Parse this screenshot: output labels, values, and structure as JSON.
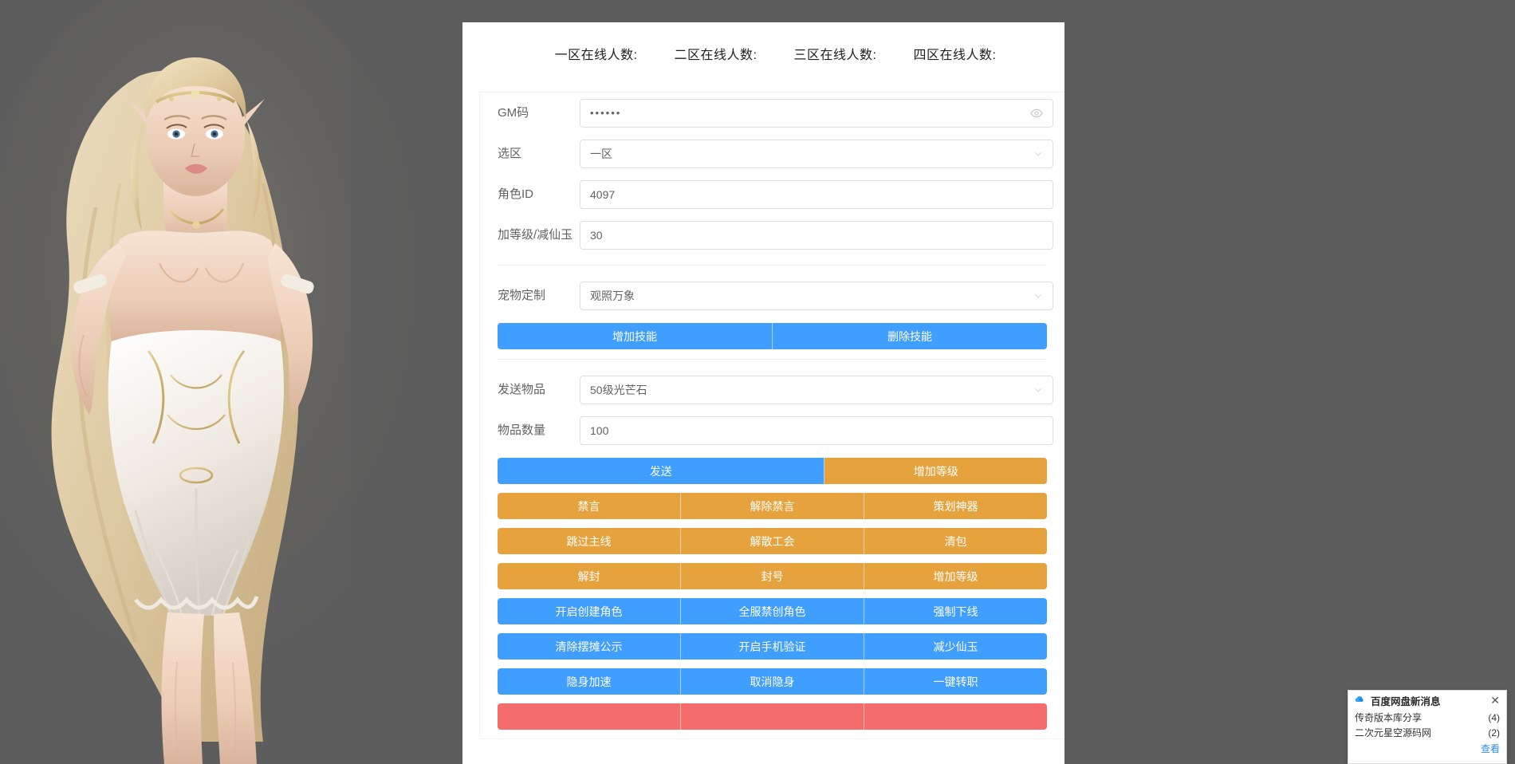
{
  "zone_header": {
    "counts": [
      "一区在线人数:",
      "二区在线人数:",
      "三区在线人数:",
      "四区在线人数:"
    ]
  },
  "form": {
    "gm_code": {
      "label": "GM码",
      "value": "••••••",
      "icon": "eye-icon"
    },
    "zone": {
      "label": "选区",
      "value": "一区"
    },
    "role_id": {
      "label": "角色ID",
      "value": "4097"
    },
    "level_jade": {
      "label": "加等级/减仙玉",
      "value": "30"
    },
    "pet_custom": {
      "label": "宠物定制",
      "value": "观照万象"
    },
    "send_item": {
      "label": "发送物品",
      "value": "50级光芒石"
    },
    "item_count": {
      "label": "物品数量",
      "value": "100"
    }
  },
  "skill_bar": [
    {
      "label": "增加技能",
      "color": "blue"
    },
    {
      "label": "删除技能",
      "color": "blue"
    }
  ],
  "send_bar": [
    {
      "label": "发送",
      "color": "blue"
    },
    {
      "label": "增加等级",
      "color": "orange"
    }
  ],
  "action_rows": [
    [
      {
        "label": "禁言",
        "color": "orange"
      },
      {
        "label": "解除禁言",
        "color": "orange"
      },
      {
        "label": "策划神器",
        "color": "orange"
      }
    ],
    [
      {
        "label": "跳过主线",
        "color": "orange"
      },
      {
        "label": "解散工会",
        "color": "orange"
      },
      {
        "label": "清包",
        "color": "orange"
      }
    ],
    [
      {
        "label": "解封",
        "color": "orange"
      },
      {
        "label": "封号",
        "color": "orange"
      },
      {
        "label": "增加等级",
        "color": "orange"
      }
    ],
    [
      {
        "label": "开启创建角色",
        "color": "blue"
      },
      {
        "label": "全服禁创角色",
        "color": "blue"
      },
      {
        "label": "强制下线",
        "color": "blue"
      }
    ],
    [
      {
        "label": "清除摆摊公示",
        "color": "blue"
      },
      {
        "label": "开启手机验证",
        "color": "blue"
      },
      {
        "label": "减少仙玉",
        "color": "blue"
      }
    ],
    [
      {
        "label": "隐身加速",
        "color": "blue"
      },
      {
        "label": "取消隐身",
        "color": "blue"
      },
      {
        "label": "一键转职",
        "color": "blue"
      }
    ],
    [
      {
        "label": "",
        "color": "red"
      },
      {
        "label": "",
        "color": "red"
      },
      {
        "label": "",
        "color": "red"
      }
    ]
  ],
  "toast": {
    "title": "百度网盘新消息",
    "close_label": "✕",
    "items": [
      {
        "name": "传奇版本库分享",
        "count": "(4)"
      },
      {
        "name": "二次元星空源码网",
        "count": "(2)"
      }
    ],
    "more_label": "查看"
  },
  "colors": {
    "blue": "#409eff",
    "orange": "#e6a23c",
    "red": "#f56c6c",
    "page_bg": "#5d5d5d",
    "panel_bg": "#ffffff",
    "label_text": "#606266",
    "border": "#dcdfe6"
  }
}
